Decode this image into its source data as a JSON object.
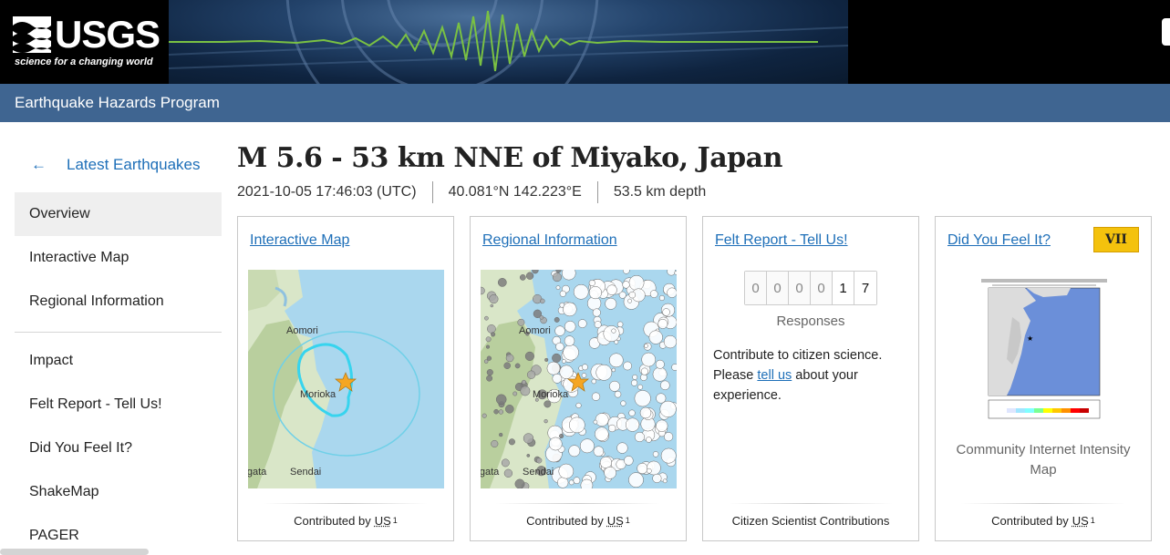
{
  "header": {
    "logo_text": "USGS",
    "tagline": "science for a changing world",
    "program": "Earthquake Hazards Program"
  },
  "sidebar": {
    "back_arrow": "←",
    "back_label": "Latest Earthquakes",
    "items": [
      {
        "label": "Overview",
        "active": true
      },
      {
        "label": "Interactive Map"
      },
      {
        "label": "Regional Information"
      },
      {
        "label": "Impact"
      },
      {
        "label": "Felt Report - Tell Us!"
      },
      {
        "label": "Did You Feel It?"
      },
      {
        "label": "ShakeMap"
      },
      {
        "label": "PAGER"
      }
    ]
  },
  "event": {
    "title": "M 5.6 - 53 km NNE of Miyako, Japan",
    "time": "2021-10-05 17:46:03 (UTC)",
    "location": "40.081°N 142.223°E",
    "depth": "53.5 km depth"
  },
  "cards": {
    "interactive_map": {
      "link": "Interactive Map",
      "contributed": "Contributed by",
      "contributor": "US",
      "sup": "1",
      "map_labels": {
        "city1": "Aomori",
        "city2": "Morioka",
        "city3": "Sendai",
        "city4": "Niigata"
      }
    },
    "regional": {
      "link": "Regional Information",
      "contributed": "Contributed by",
      "contributor": "US",
      "sup": "1",
      "map_labels": {
        "city1": "Aomori",
        "city2": "Morioka",
        "city3": "Sendai",
        "city4": "Niigata"
      }
    },
    "felt": {
      "link": "Felt Report - Tell Us!",
      "digits": [
        "0",
        "0",
        "0",
        "0",
        "1",
        "7"
      ],
      "responses": "Responses",
      "text_before": "Contribute to citizen science. Please",
      "link_text": "tell us",
      "text_after": "about your experience.",
      "footer": "Citizen Scientist Contributions"
    },
    "dyfi": {
      "link": "Did You Feel It?",
      "badge": "VII",
      "caption": "Community Internet Intensity Map",
      "contributed": "Contributed by",
      "contributor": "US",
      "sup": "1"
    }
  },
  "colors": {
    "program_bar": "#3f6591",
    "link": "#1e6fb8",
    "badge": "#f4c20d",
    "event_star": "#f5a623",
    "seismogram": "#7ac143"
  }
}
